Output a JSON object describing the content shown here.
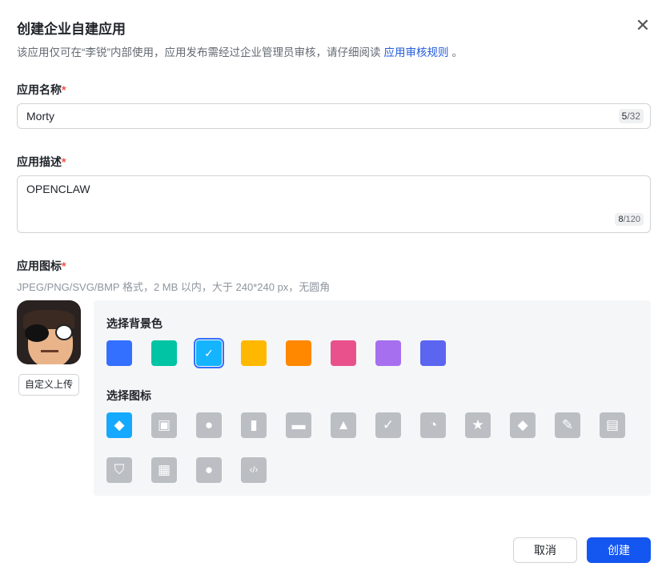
{
  "dialog": {
    "title": "创建企业自建应用",
    "subtitle": "该应用仅可在“李锐”内部使用，应用发布需经过企业管理员审核，请仔细阅读",
    "review_link": "应用审核规则",
    "subtitle_end": "。"
  },
  "name_field": {
    "label": "应用名称",
    "required": "*",
    "value": "Morty",
    "count": "5",
    "max": "/32"
  },
  "desc_field": {
    "label": "应用描述",
    "required": "*",
    "value": "OPENCLAW",
    "count": "8",
    "max": "/120"
  },
  "icon_field": {
    "label": "应用图标",
    "required": "*",
    "hint": "JPEG/PNG/SVG/BMP 格式，2 MB 以内，大于 240*240 px，无圆角",
    "upload_label": "自定义上传"
  },
  "panel": {
    "bg_label": "选择背景色",
    "colors": [
      "#3370ff",
      "#00c4a3",
      "#14b4ff",
      "#ffb800",
      "#ff8800",
      "#e8518c",
      "#a66ff0",
      "#5b65f0"
    ],
    "selected_color": 2,
    "check": "✓",
    "icon_label": "选择图标",
    "icons": [
      {
        "name": "cube",
        "glyph": "◆"
      },
      {
        "name": "robot",
        "glyph": "▣"
      },
      {
        "name": "lightbulb",
        "glyph": "●"
      },
      {
        "name": "door",
        "glyph": "▮"
      },
      {
        "name": "briefcase",
        "glyph": "▬"
      },
      {
        "name": "bell",
        "glyph": "▲"
      },
      {
        "name": "bookmark-check",
        "glyph": "✓"
      },
      {
        "name": "pie-chart",
        "glyph": "◔"
      },
      {
        "name": "star",
        "glyph": "★"
      },
      {
        "name": "tag",
        "glyph": "◆"
      },
      {
        "name": "wrench",
        "glyph": "✎"
      },
      {
        "name": "document",
        "glyph": "▤"
      },
      {
        "name": "shield",
        "glyph": "⛉"
      },
      {
        "name": "layout",
        "glyph": "▦"
      },
      {
        "name": "users",
        "glyph": "●"
      },
      {
        "name": "code",
        "glyph": "‹/›"
      }
    ],
    "selected_icon": 0
  },
  "footer": {
    "cancel": "取消",
    "create": "创建"
  }
}
